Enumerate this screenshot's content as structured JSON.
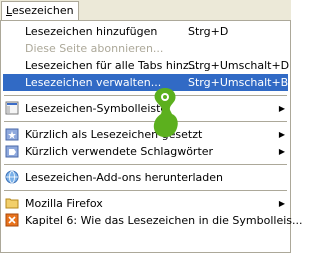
{
  "menubar": {
    "title_first": "L",
    "title_rest": "esezeichen"
  },
  "menu": {
    "items": [
      {
        "label": "Lesezeichen hinzufügen",
        "shortcut": "Strg+D"
      },
      {
        "label": "Diese Seite abonnieren...",
        "shortcut": ""
      },
      {
        "label": "Lesezeichen für alle Tabs hinz...",
        "shortcut": "Strg+Umschalt+D"
      },
      {
        "label": "Lesezeichen verwalten...",
        "shortcut": "Strg+Umschalt+B"
      },
      {
        "label": "Lesezeichen-Symbolleiste",
        "icon": "bookmark-toolbar-icon"
      },
      {
        "label": "Kürzlich als Lesezeichen gesetzt",
        "icon": "folder-star-icon"
      },
      {
        "label": "Kürzlich verwendete Schlagwörter",
        "icon": "tag-icon"
      },
      {
        "label": "Lesezeichen-Add-ons herunterladen",
        "icon": "addons-globe-icon"
      },
      {
        "label": "Mozilla Firefox",
        "icon": "folder-icon"
      },
      {
        "label": "Kapitel 6: Wie das Lesezeichen in die Symbolleis...",
        "icon": "page-icon"
      }
    ]
  },
  "colors": {
    "highlight": "#316ac5",
    "disabled": "#aca899",
    "cursor_blob": "#5cb01e"
  }
}
